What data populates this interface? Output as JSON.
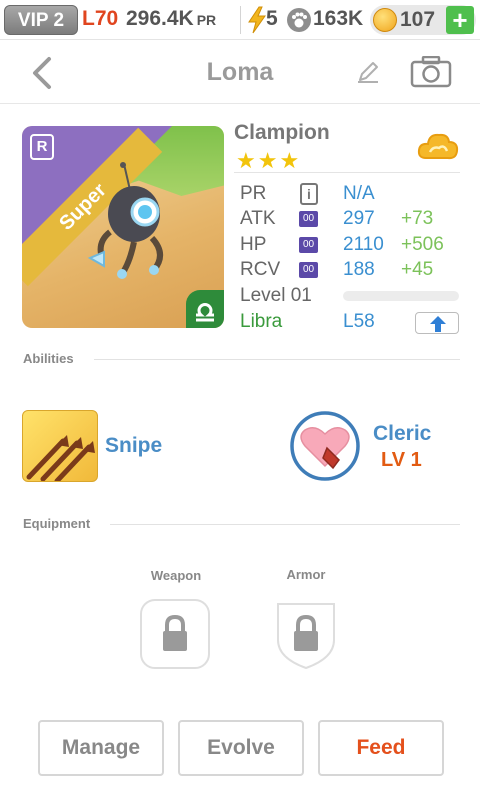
{
  "status_bar": {
    "vip": "VIP 2",
    "level": "L70",
    "pr_value": "296.4K",
    "pr_unit": "PR",
    "energy": "5",
    "paws": "163K",
    "coins": "107",
    "add_label": "+"
  },
  "header": {
    "title": "Loma"
  },
  "pet": {
    "name": "Clampion",
    "stars": "★★★",
    "rarity_badge": "R",
    "rarity_band": "Super",
    "stats": {
      "pr": {
        "label": "PR",
        "value": "N/A"
      },
      "atk": {
        "label": "ATK",
        "value": "297",
        "bonus": "+73"
      },
      "hp": {
        "label": "HP",
        "value": "2110",
        "bonus": "+506"
      },
      "rcv": {
        "label": "RCV",
        "value": "188",
        "bonus": "+45"
      },
      "level": {
        "label": "Level 01"
      },
      "sign": {
        "name": "Libra",
        "value": "L58"
      }
    },
    "stat_icon_text": "00"
  },
  "abilities": {
    "title": "Abilities",
    "skill": {
      "name": "Snipe"
    },
    "class": {
      "name": "Cleric",
      "level": "LV 1"
    }
  },
  "equipment": {
    "title": "Equipment",
    "weapon_label": "Weapon",
    "armor_label": "Armor"
  },
  "actions": {
    "manage": "Manage",
    "evolve": "Evolve",
    "feed": "Feed"
  },
  "colors": {
    "accent_blue": "#3a8fd0",
    "bonus_green": "#7cc25a",
    "feed_orange": "#e4501c",
    "sign_green": "#3a9a3c"
  },
  "icons": {
    "back": "chevron-left-icon",
    "edit": "pencil-icon",
    "camera": "camera-icon",
    "element": "cloud-icon",
    "lock": "lock-icon"
  }
}
